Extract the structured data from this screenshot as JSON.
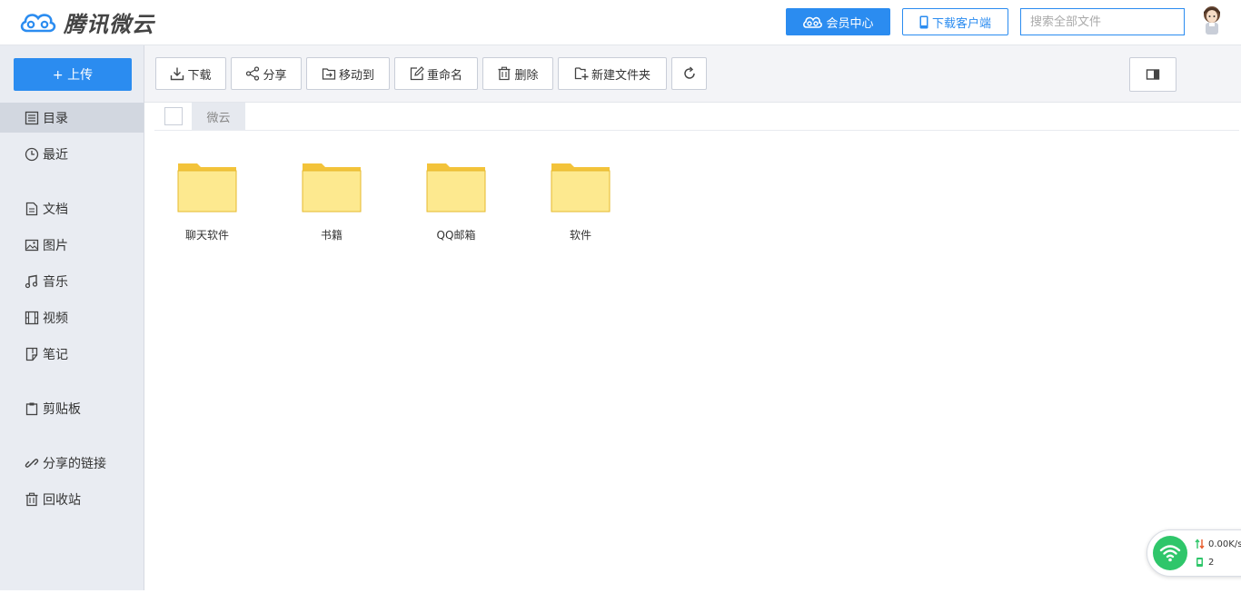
{
  "header": {
    "logo_text": "腾讯微云",
    "vip_label": "会员中心",
    "client_label": "下载客户端",
    "search_placeholder": "搜索全部文件"
  },
  "sidebar": {
    "upload_label": "+ 上传",
    "items": [
      {
        "label": "目录",
        "icon": "directory-icon",
        "active": true
      },
      {
        "label": "最近",
        "icon": "clock-icon"
      },
      {
        "label": "文档",
        "icon": "document-icon"
      },
      {
        "label": "图片",
        "icon": "image-icon"
      },
      {
        "label": "音乐",
        "icon": "music-icon"
      },
      {
        "label": "视频",
        "icon": "video-icon"
      },
      {
        "label": "笔记",
        "icon": "note-icon"
      },
      {
        "label": "剪贴板",
        "icon": "clipboard-icon"
      },
      {
        "label": "分享的链接",
        "icon": "link-icon"
      },
      {
        "label": "回收站",
        "icon": "trash-icon"
      }
    ]
  },
  "toolbar": {
    "download": "下载",
    "share": "分享",
    "move": "移动到",
    "rename": "重命名",
    "delete": "删除",
    "new_folder": "新建文件夹"
  },
  "breadcrumb": {
    "root": "微云"
  },
  "folders": [
    {
      "name": "聊天软件"
    },
    {
      "name": "书籍"
    },
    {
      "name": "QQ邮箱"
    },
    {
      "name": "软件"
    }
  ],
  "widget": {
    "speed": "0.00K/s",
    "count": "2"
  },
  "colors": {
    "accent": "#2b8cf0",
    "folder": "#fde98f",
    "folder_tab": "#f3c33a",
    "wifi": "#2fc66a"
  }
}
